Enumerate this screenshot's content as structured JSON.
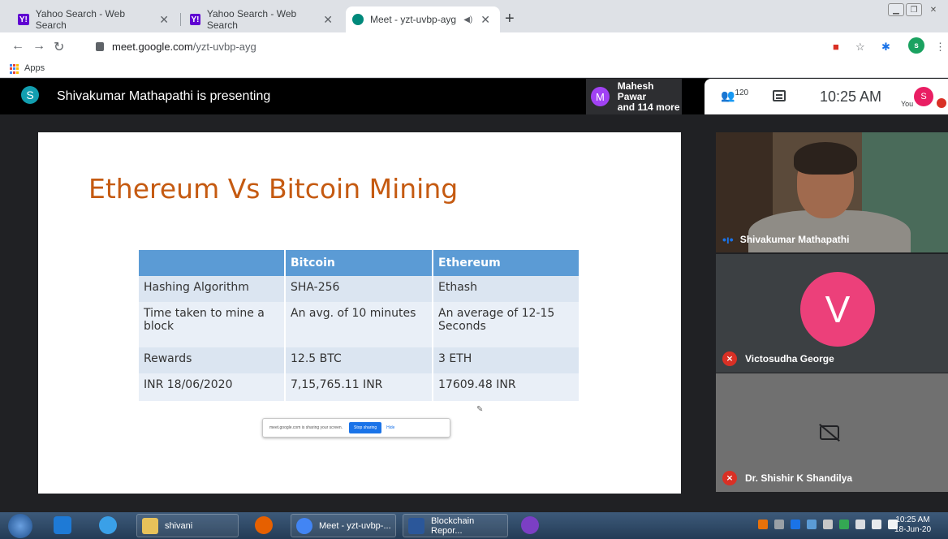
{
  "browser": {
    "tabs": [
      {
        "title": "Yahoo Search - Web Search",
        "favicon": "yahoo-icon"
      },
      {
        "title": "Yahoo Search - Web Search",
        "favicon": "yahoo-icon"
      },
      {
        "title": "Meet - yzt-uvbp-ayg",
        "favicon": "meet-icon",
        "active": true
      }
    ],
    "url_host": "meet.google.com",
    "url_path": "/yzt-uvbp-ayg",
    "bookmarks": [
      {
        "label": "Apps"
      }
    ],
    "profile_initial": "s"
  },
  "meet": {
    "presenter_initial": "S",
    "presenting_text": "Shivakumar Mathapathi is presenting",
    "people_chip_initial": "M",
    "people_chip_line1": "Mahesh Pawar",
    "people_chip_line2": "and 114 more",
    "participant_count": "120",
    "time": "10:25 AM",
    "you_label": "You",
    "you_initial": "S",
    "tiles": [
      {
        "name": "Shivakumar Mathapathi",
        "state": "speaking"
      },
      {
        "name": "Victosudha George",
        "initial": "V",
        "state": "muted"
      },
      {
        "name": "Dr. Shishir K Shandilya",
        "state": "muted",
        "camera": "off"
      }
    ]
  },
  "slide": {
    "title": "Ethereum Vs Bitcoin Mining",
    "table": {
      "headers": [
        "",
        "Bitcoin",
        "Ethereum"
      ],
      "rows": [
        [
          "Hashing Algorithm",
          "SHA-256",
          "Ethash"
        ],
        [
          "Time taken to mine a block",
          "An avg. of 10 minutes",
          "An average of 12-15 Seconds"
        ],
        [
          "Rewards",
          "12.5 BTC",
          "3 ETH"
        ],
        [
          "INR 18/06/2020",
          "7,15,765.11 INR",
          "17609.48 INR"
        ]
      ]
    },
    "share_bar": {
      "text": "meet.google.com is sharing your screen.",
      "stop_label": "Stop sharing",
      "hide_label": "Hide"
    }
  },
  "taskbar": {
    "buttons": [
      {
        "label": "shivani"
      },
      {
        "label": "Meet - yzt-uvbp-..."
      },
      {
        "label": "Blockchain Repor..."
      }
    ],
    "clock_time": "10:25 AM",
    "clock_date": "18-Jun-20"
  },
  "colors": {
    "slide_title": "#c55a11",
    "table_header": "#5b9bd5",
    "meet_bg": "#202124",
    "mute_red": "#d93025",
    "avatar_pink": "#ec407a"
  }
}
